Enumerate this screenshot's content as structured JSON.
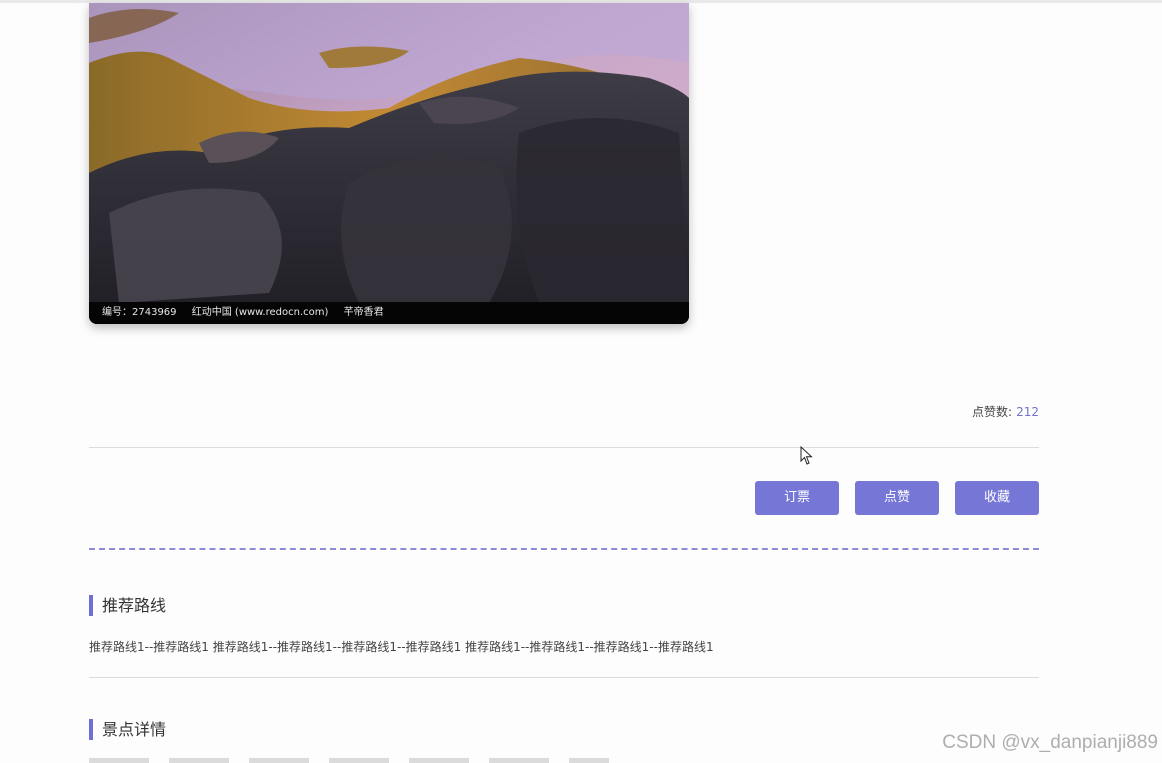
{
  "photo": {
    "caption": {
      "id_text": "编号：2743969",
      "source_text": "红动中国 (www.redocn.com)",
      "author_text": "芊帝香君"
    }
  },
  "likes": {
    "label": "点赞数:",
    "count": "212"
  },
  "actions": {
    "book_label": "订票",
    "like_label": "点赞",
    "favorite_label": "收藏"
  },
  "sections": {
    "recommended_routes": {
      "title": "推荐路线",
      "text": "推荐路线1--推荐路线1 推荐路线1--推荐路线1--推荐路线1--推荐路线1 推荐路线1--推荐路线1--推荐路线1--推荐路线1"
    },
    "attraction_details": {
      "title": "景点详情"
    }
  },
  "watermark": "CSDN @vx_danpianji889",
  "colors": {
    "accent": "#7676d6",
    "like_count": "#7272cf",
    "dashed_divider": "#8b8bd8"
  }
}
